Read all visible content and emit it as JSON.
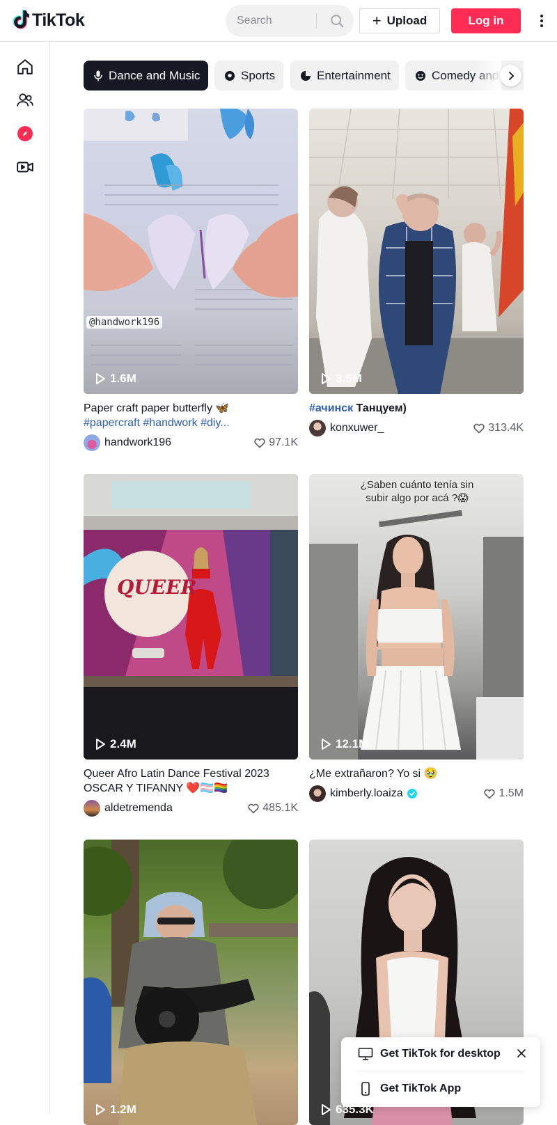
{
  "brand": {
    "name": "TikTok"
  },
  "header": {
    "search_placeholder": "Search",
    "upload_label": "Upload",
    "login_label": "Log in"
  },
  "sidebar": {
    "items": [
      {
        "icon": "home-icon"
      },
      {
        "icon": "following-icon"
      },
      {
        "icon": "explore-icon",
        "active": true
      },
      {
        "icon": "live-icon"
      }
    ]
  },
  "categories": [
    {
      "label": "Dance and Music",
      "icon": "microphone-icon",
      "active": true
    },
    {
      "label": "Sports",
      "icon": "ball-icon"
    },
    {
      "label": "Entertainment",
      "icon": "entertainment-icon"
    },
    {
      "label": "Comedy and",
      "icon": "comedy-icon"
    }
  ],
  "videos": [
    {
      "views": "1.6M",
      "caption_text": "Paper craft paper butterfly 🦋",
      "caption_tags": "#papercraft #handwork #diy...",
      "author": "handwork196",
      "likes": "97.1K",
      "verified": false,
      "overlay_text": "@handwork196"
    },
    {
      "views": "3.5M",
      "caption_tags": "#ачинск",
      "caption_text": " Танцуем)",
      "author": "konxuwer_",
      "likes": "313.4K",
      "verified": false
    },
    {
      "views": "2.4M",
      "caption_text": "Queer Afro Latin Dance Festival 2023 OSCAR Y TIFANNY ❤️🏳️‍⚧️🏳️‍🌈",
      "author": "aldetremenda",
      "likes": "485.1K",
      "verified": false,
      "overlay_text": "QUEER"
    },
    {
      "views": "12.1M",
      "caption_text": "¿Me extrañaron? Yo si 🥹",
      "author": "kimberly.loaiza",
      "likes": "1.5M",
      "verified": true,
      "overlay_text": "¿Saben cuánto tenía sin subir algo por acá ?😱"
    },
    {
      "views": "1.2M"
    },
    {
      "views": "635.3K"
    }
  ],
  "popup": {
    "desktop_label": "Get TikTok for desktop",
    "app_label": "Get TikTok App"
  },
  "colors": {
    "accent": "#fe2c55",
    "tag": "#2b5db9",
    "verified": "#20d5ec"
  }
}
